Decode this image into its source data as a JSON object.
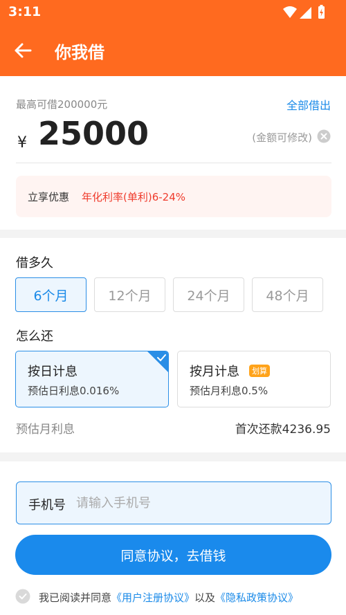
{
  "status_bar": {
    "time": "3:11",
    "icons": [
      "wifi-icon",
      "signal-icon",
      "battery-charging-icon"
    ]
  },
  "header": {
    "title": "你我借",
    "back_icon": "arrow-left-icon"
  },
  "amount_card": {
    "max_label": "最高可借200000元",
    "borrow_all": "全部借出",
    "currency": "¥",
    "amount": "25000",
    "hint": "(金额可修改)",
    "clear_icon": "close-circle-icon",
    "promo_label": "立享优惠",
    "promo_rate": "年化利率(单利)6-24%"
  },
  "term": {
    "title": "借多久",
    "options": [
      "6个月",
      "12个月",
      "24个月",
      "48个月"
    ],
    "selected": "6个月"
  },
  "repay": {
    "title": "怎么还",
    "methods": [
      {
        "title": "按日计息",
        "sub": "预估日利息0.016%",
        "selected": true
      },
      {
        "title": "按月计息",
        "sub": "预估月利息0.5%",
        "badge": "划算",
        "selected": false
      }
    ],
    "estimate_label": "预估月利息",
    "first_repayment": "首次还款4236.95"
  },
  "form": {
    "phone_label": "手机号",
    "phone_placeholder": "请输入手机号",
    "phone_value": "",
    "submit": "同意协议，去借钱",
    "agree_prefix": "我已阅读并同意",
    "agree_link1": "《用户注册协议》",
    "agree_mid": "以及",
    "agree_link2": "《隐私政策协议》"
  },
  "colors": {
    "brand_orange": "#ff6a1f",
    "accent_blue": "#1a8aec",
    "promo_red": "#ef3b2c",
    "badge_orange": "#ffa31a"
  }
}
